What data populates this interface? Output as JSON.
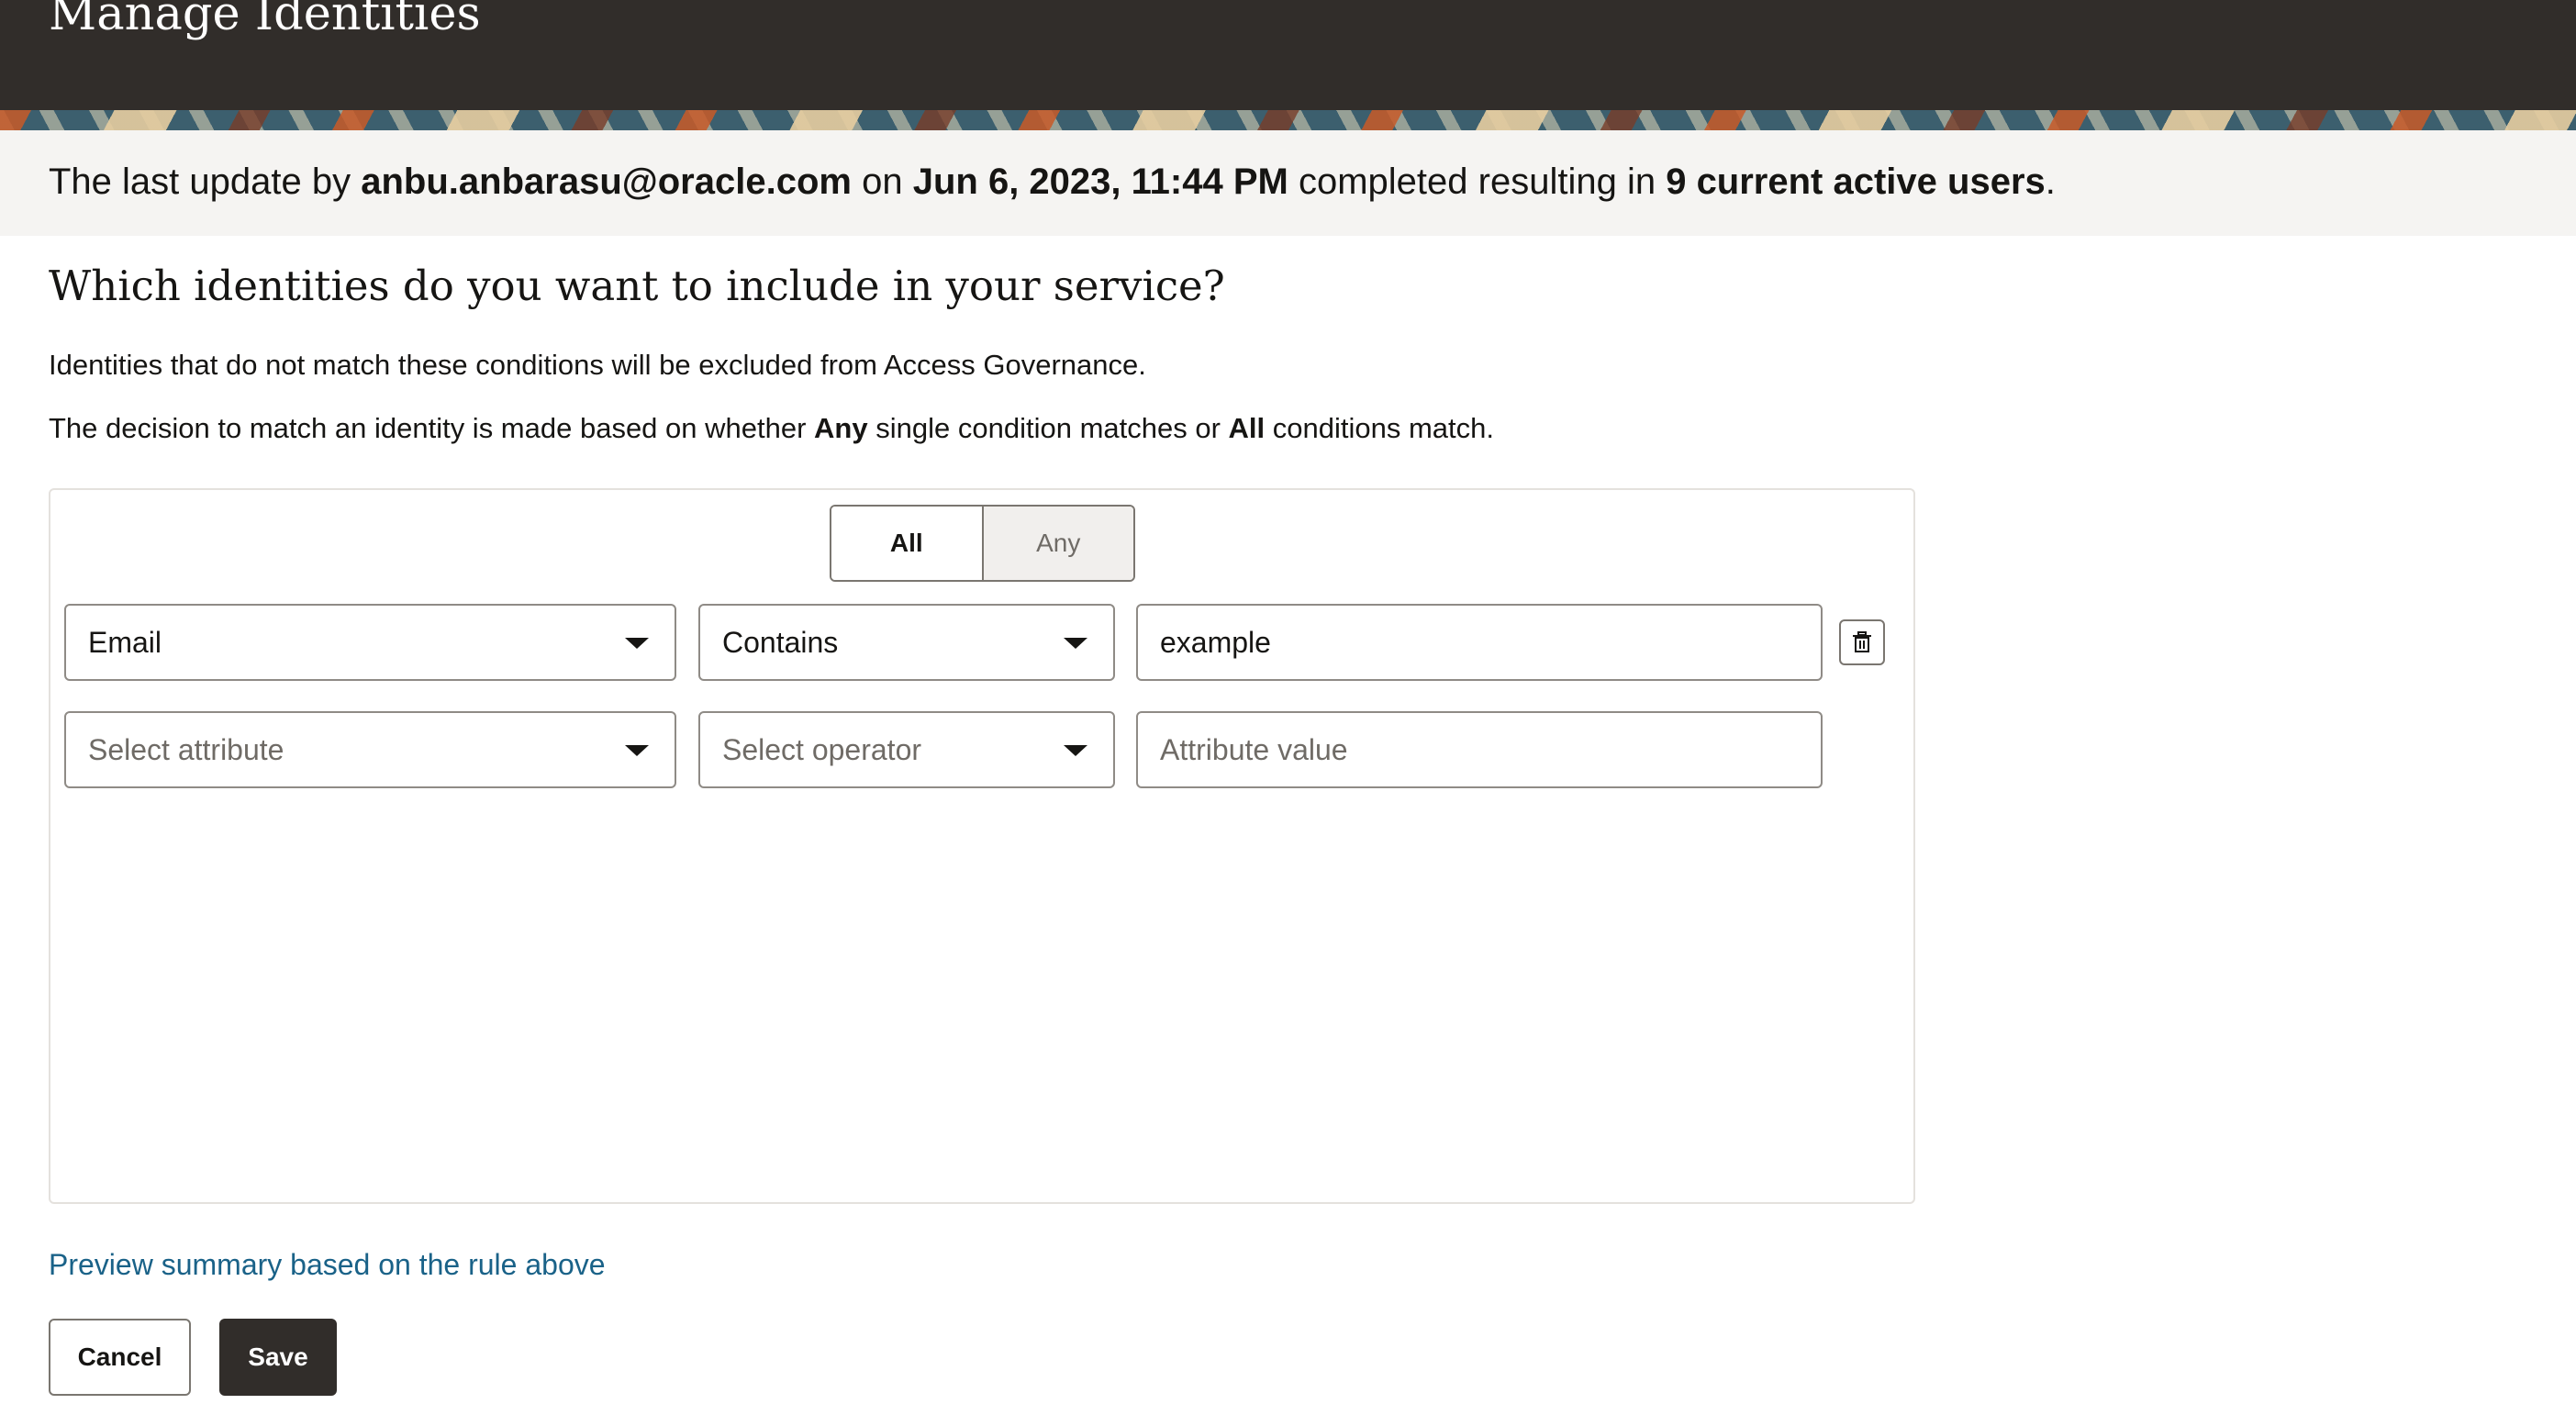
{
  "header": {
    "title": "Manage Identities"
  },
  "status": {
    "prefix": "The last update by",
    "user": "anbu.anbarasu@oracle.com",
    "on": "on",
    "datetime": "Jun 6, 2023, 11:44 PM",
    "middle": "completed resulting in",
    "count_text": "9 current active users",
    "suffix": "."
  },
  "question": "Which identities do you want to include in your service?",
  "description1": "Identities that do not match these conditions will be excluded from Access Governance.",
  "description2": {
    "part1": "The decision to match an identity is made based on whether",
    "any": "Any",
    "part2": "single condition matches or",
    "all": "All",
    "part3": "conditions match."
  },
  "toggle": {
    "all_label": "All",
    "any_label": "Any",
    "selected": "All"
  },
  "rules": [
    {
      "attribute": "Email",
      "operator": "Contains",
      "value": "example"
    }
  ],
  "new_rule": {
    "attribute_placeholder": "Select attribute",
    "operator_placeholder": "Select operator",
    "value_placeholder": "Attribute value"
  },
  "icons": {
    "delete": "trash-icon",
    "dropdown": "chevron-down-icon"
  },
  "preview_link": "Preview summary based on the rule above",
  "actions": {
    "cancel_label": "Cancel",
    "save_label": "Save"
  },
  "colors": {
    "header_bg": "#312d2a",
    "link": "#1a6288",
    "save_bg": "#312d2a",
    "info_bg": "#f5f4f2"
  }
}
